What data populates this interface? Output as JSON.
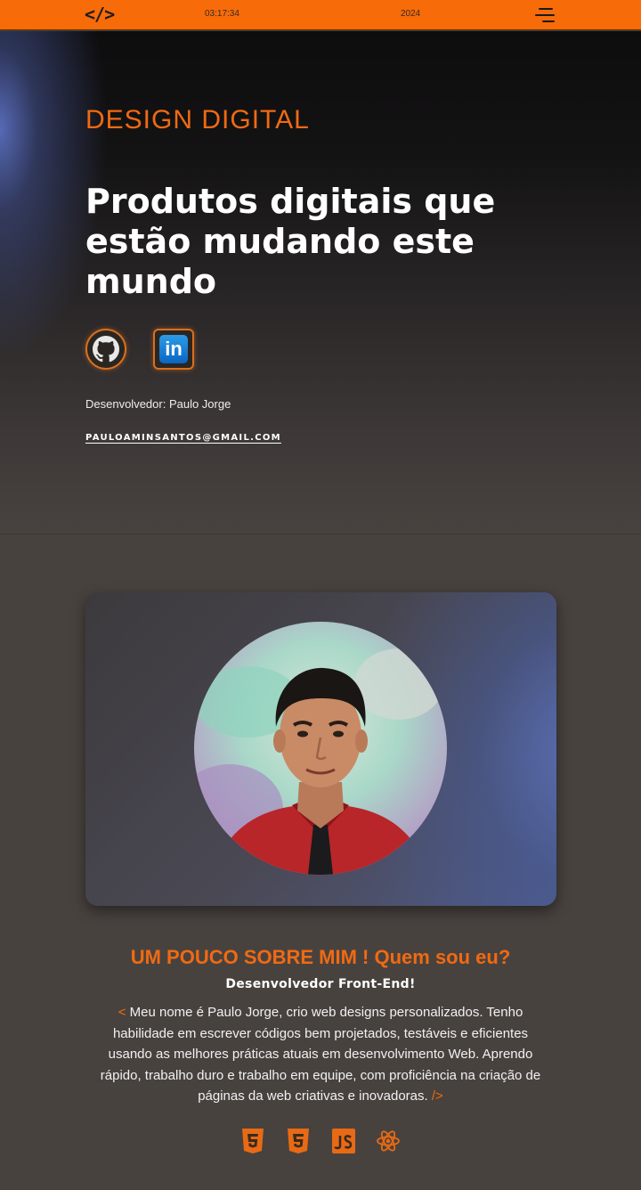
{
  "header": {
    "logo": "</>",
    "clock": "03:17:34",
    "year": "2024",
    "menu_icon": "hamburger-menu-icon"
  },
  "hero": {
    "kicker": "DESIGN DIGITAL",
    "headline": "Produtos digitais que estão mudando este mundo",
    "social": [
      {
        "name": "GitHub",
        "icon": "github-icon"
      },
      {
        "name": "LinkedIn",
        "icon": "linkedin-icon",
        "glyph": "in"
      }
    ],
    "developer": "Desenvolvedor: Paulo Jorge",
    "email": "PAULOAMINSANTOS@GMAIL.COM"
  },
  "about": {
    "title": "UM POUCO SOBRE MIM ! Quem sou eu?",
    "subtitle": "Desenvolvedor Front-End!",
    "open_tag": "<",
    "text": "Meu nome é Paulo Jorge, crio web designs personalizados. Tenho habilidade em escrever códigos bem projetados, testáveis e eficientes usando as melhores práticas atuais em desenvolvimento Web. Aprendo rápido, trabalho duro e trabalho em equipe, com proficiência na criação de páginas da web criativas e inovadoras.",
    "close_tag": "/>",
    "tech_icons": [
      "html5-icon",
      "css3-icon",
      "javascript-icon",
      "react-icon"
    ]
  },
  "colors": {
    "accent": "#f76b09",
    "background": "#48423f",
    "text": "#ffffff"
  }
}
